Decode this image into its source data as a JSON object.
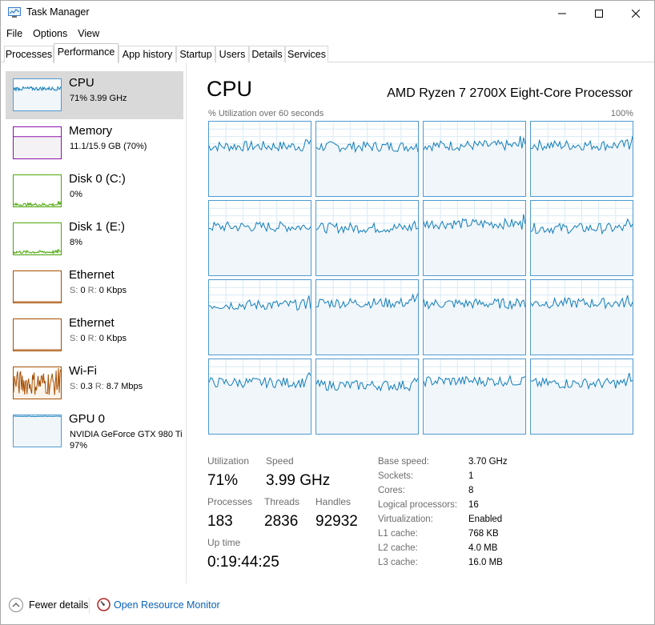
{
  "window": {
    "title": "Task Manager"
  },
  "menu": [
    "File",
    "Options",
    "View"
  ],
  "tabs": [
    "Processes",
    "Performance",
    "App history",
    "Startup",
    "Users",
    "Details",
    "Services"
  ],
  "active_tab": "Performance",
  "sidebar": [
    {
      "title": "CPU",
      "sub": "71% 3.99 GHz",
      "color": "#117dbb",
      "fill": "#f1f6fa"
    },
    {
      "title": "Memory",
      "sub": "11.1/15.9 GB (70%)",
      "color": "#8b12ae",
      "fill": "#f4f2f4"
    },
    {
      "title": "Disk 0 (C:)",
      "sub": "0%",
      "color": "#4da60c",
      "fill": "#eff7e8"
    },
    {
      "title": "Disk 1 (E:)",
      "sub": "8%",
      "color": "#4da60c",
      "fill": "#eff7e8"
    },
    {
      "title": "Ethernet",
      "sub_a_label": "S:",
      "sub_a": "0",
      "sub_b_label": "R:",
      "sub_b": "0 Kbps",
      "color": "#a74f01",
      "fill": "#fcf3eb"
    },
    {
      "title": "Ethernet",
      "sub_a_label": "S:",
      "sub_a": "0",
      "sub_b_label": "R:",
      "sub_b": "0 Kbps",
      "color": "#a74f01",
      "fill": "#fcf3eb"
    },
    {
      "title": "Wi-Fi",
      "sub_a_label": "S:",
      "sub_a": "0.3",
      "sub_b_label": "R:",
      "sub_b": "8.7 Mbps",
      "color": "#a74f01",
      "fill": "#fcf3eb"
    },
    {
      "title": "GPU 0",
      "sub": "NVIDIA GeForce GTX 980 Ti",
      "sub2": "97%",
      "color": "#117dbb",
      "fill": "#f1f6fa"
    }
  ],
  "main": {
    "title": "CPU",
    "model": "AMD Ryzen 7 2700X Eight-Core Processor",
    "graph_label": "% Utilization over 60 seconds",
    "graph_max": "100%",
    "stats": {
      "utilization_label": "Utilization",
      "utilization": "71%",
      "speed_label": "Speed",
      "speed": "3.99 GHz",
      "processes_label": "Processes",
      "processes": "183",
      "threads_label": "Threads",
      "threads": "2836",
      "handles_label": "Handles",
      "handles": "92932",
      "uptime_label": "Up time",
      "uptime": "0:19:44:25"
    },
    "specs": [
      {
        "label": "Base speed:",
        "value": "3.70 GHz"
      },
      {
        "label": "Sockets:",
        "value": "1"
      },
      {
        "label": "Cores:",
        "value": "8"
      },
      {
        "label": "Logical processors:",
        "value": "16"
      },
      {
        "label": "Virtualization:",
        "value": "Enabled"
      },
      {
        "label": "L1 cache:",
        "value": "768 KB"
      },
      {
        "label": "L2 cache:",
        "value": "4.0 MB"
      },
      {
        "label": "L3 cache:",
        "value": "16.0 MB"
      }
    ]
  },
  "footer": {
    "fewer_details": "Fewer details",
    "resource_monitor": "Open Resource Monitor"
  },
  "colors": {
    "cpu_line": "#117dbb",
    "cpu_fill": "#f1f6fa",
    "grid": "#d9eaf4",
    "link": "#0a62b9"
  }
}
